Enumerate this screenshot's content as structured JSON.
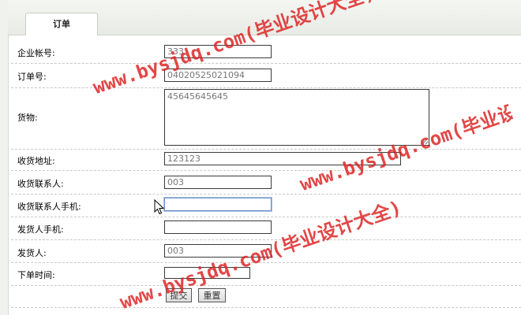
{
  "tab": {
    "label": "订单"
  },
  "form": {
    "company_account": {
      "label": "企业帐号:",
      "value": "333"
    },
    "order_no": {
      "label": "订单号:",
      "value": "04020525021094"
    },
    "goods": {
      "label": "货物:",
      "value": "45645645645"
    },
    "ship_address": {
      "label": "收货地址:",
      "value": "123123"
    },
    "receiver": {
      "label": "收货联系人:",
      "value": "003"
    },
    "receiver_phone": {
      "label": "收货联系人手机:",
      "value": ""
    },
    "sender_phone": {
      "label": "发货人手机:",
      "value": ""
    },
    "sender": {
      "label": "发货人:",
      "value": "003"
    },
    "order_time": {
      "label": "下单时间:",
      "value": ""
    },
    "submit_label": "提交",
    "reset_label": "重置"
  },
  "watermark": {
    "text": "www.bysjdq.com(毕业设计大全)",
    "color": "#dc1e1e"
  },
  "colors": {
    "tab_bg": "#e8ebe5",
    "field_border": "#3a3a3a",
    "focus_border": "#6b8fc7"
  }
}
